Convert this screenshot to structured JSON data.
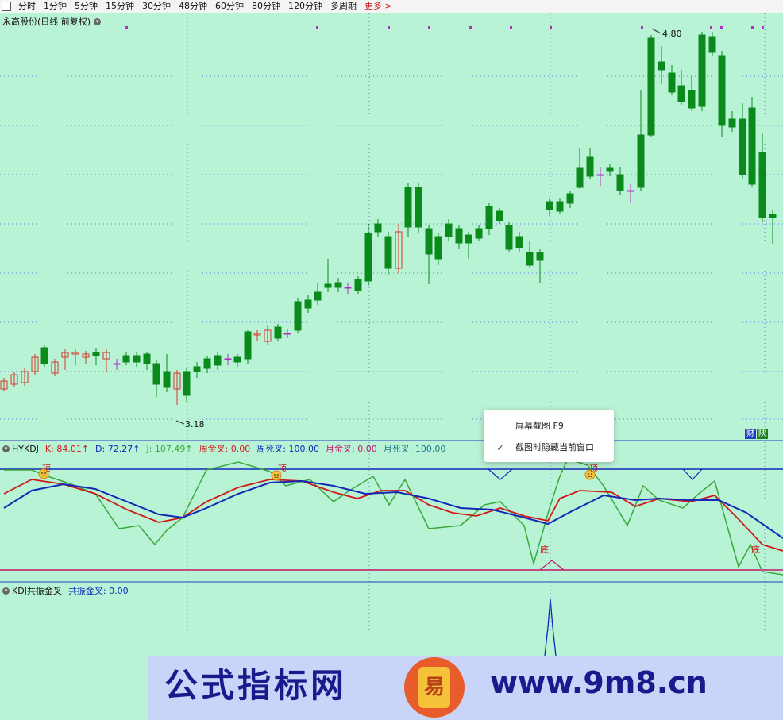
{
  "toolbar": {
    "items": [
      "分时",
      "1分钟",
      "5分钟",
      "15分钟",
      "30分钟",
      "48分钟",
      "60分钟",
      "80分钟",
      "120分钟",
      "多周期"
    ],
    "more": "更多 >"
  },
  "stock": {
    "title": "永高股份(日线 前复权)"
  },
  "price_labels": {
    "high": "4.80",
    "low": "3.18"
  },
  "badges": {
    "cai": "财",
    "yang": "陕"
  },
  "hykdj": {
    "name": "HYKDJ",
    "k": "K: 84.01↑",
    "d": "D: 72.27↑",
    "j": "J: 107.49↑",
    "week_golden": "周金叉: 0.00",
    "week_dead": "周死叉: 100.00",
    "month_golden": "月金叉: 0.00",
    "month_dead": "月死叉: 100.00",
    "top_label": "顶",
    "bottom_label": "底"
  },
  "kdj2": {
    "name": "KDJ共振金叉",
    "value": "共振金叉: 0.00"
  },
  "context_menu": {
    "item1": "屏幕截图 F9",
    "item2": "截图时隐藏当前窗口",
    "check": "✓"
  },
  "watermark": {
    "text_cn": "公式指标网",
    "text_url": "www.9m8.cn",
    "logo_char": "易"
  },
  "colors": {
    "up": "#d43a2a",
    "down": "#0a8a1a",
    "bg": "#b9f3d6",
    "k": "#d01818",
    "d": "#1428b8",
    "j": "#3aa83a"
  }
}
